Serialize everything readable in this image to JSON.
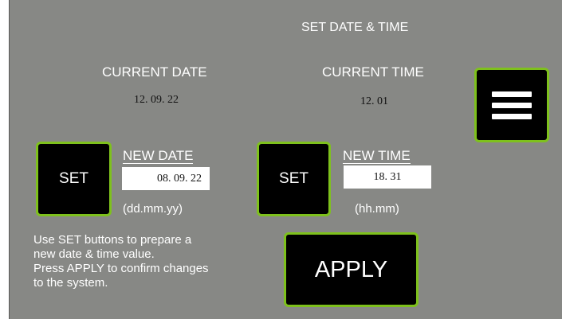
{
  "screen": {
    "title": "SET DATE & TIME",
    "accent_color": "#7ec11c",
    "background_color": "#878885"
  },
  "current": {
    "date_label": "CURRENT DATE",
    "date_value": "12. 09. 22",
    "time_label": "CURRENT TIME",
    "time_value": "12. 01"
  },
  "menu_button": {
    "icon": "hamburger-menu-icon"
  },
  "new_date": {
    "set_label": "SET",
    "label": "NEW DATE",
    "value": "08. 09. 22",
    "format": "(dd.mm.yy)"
  },
  "new_time": {
    "set_label": "SET",
    "label": "NEW TIME",
    "value": "18. 31",
    "format": "(hh.mm)"
  },
  "help_text": {
    "lines": [
      "Use SET buttons to prepare a",
      "new date & time value.",
      "Press APPLY to confirm changes",
      "to the system."
    ]
  },
  "apply_button": {
    "label": "APPLY"
  }
}
